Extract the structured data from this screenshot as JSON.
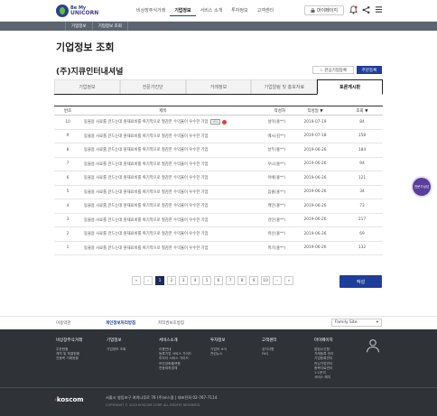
{
  "header": {
    "logo_line1": "Be My",
    "logo_line2": "UNICORN",
    "nav": [
      "비상장주식거래",
      "기업정보",
      "서비스 소개",
      "투자정보",
      "고객센터"
    ],
    "active_nav": "기업정보",
    "mypage": "마이페이지"
  },
  "breadcrumb": [
    "기업정보",
    "기업정보 조회"
  ],
  "page_title": "기업정보 조회",
  "company_name": "(주)지큐인터내셔널",
  "buttons": {
    "watch": "☆ 관심기업등록",
    "stock": "주문등록",
    "write": "작성"
  },
  "tabs": [
    "기업정보",
    "전문가진단",
    "거래정보",
    "기업알림 및 홍보자료",
    "토론게시판"
  ],
  "active_tab": "토론게시판",
  "table": {
    "headers": [
      "번호",
      "제목",
      "작성자",
      "작성일 ▼",
      "조회 ▼"
    ],
    "rows": [
      {
        "no": "10",
        "title": "동물용 사료를 만드는데 원재료비를 획기적으로 절감한 수익율이 우수한 기업",
        "writer": "설이(홍**)",
        "date": "2019-07-19",
        "views": "84",
        "img": "IMG"
      },
      {
        "no": "9",
        "title": "동물용 사료를 만드는데 원재료비를 획기적으로 절감한 수익율이 우수한 기업",
        "writer": "메시(김**)",
        "date": "2019-07-18",
        "views": "158"
      },
      {
        "no": "8",
        "title": "동물용 사료를 만드는데 원재료비를 획기적으로 절감한 수익율이 우수한 기업",
        "writer": "날두(홍**)",
        "date": "2019-06-26",
        "views": "184"
      },
      {
        "no": "7",
        "title": "동물용 사료를 만드는데 원재료비를 획기적으로 절감한 수익율이 우수한 기업",
        "writer": "우니(홍**)",
        "date": "2019-06-26",
        "views": "94"
      },
      {
        "no": "6",
        "title": "동물용 사료를 만드는데 원재료비를 획기적으로 절감한 수익율이 우수한 기업",
        "writer": "이베(홍**)",
        "date": "2019-06-26",
        "views": "121"
      },
      {
        "no": "5",
        "title": "동물용 사료를 만드는데 원재료비를 획기적으로 절감한 수익율이 우수한 기업",
        "writer": "음콜(홍**)",
        "date": "2019-06-26",
        "views": "34"
      },
      {
        "no": "4",
        "title": "동물용 사료를 만드는데 원재료비를 획기적으로 절감한 수익율이 우수한 기업",
        "writer": "케인(홍**)",
        "date": "2019-06-26",
        "views": "73"
      },
      {
        "no": "3",
        "title": "동물용 사료를 만드는데 원재료비를 획기적으로 절감한 수익율이 우수한 기업",
        "writer": "강인(홍**)",
        "date": "2019-06-26",
        "views": "217"
      },
      {
        "no": "2",
        "title": "동물용 사료를 만드는데 원재료비를 획기적으로 절감한 수익율이 우수한 기업",
        "writer": "박신(홍**)",
        "date": "2019-06-26",
        "views": "69"
      },
      {
        "no": "1",
        "title": "동물용 사료를 만드는데 원재료비를 획기적으로 절감한 수익율이 우수한 기업",
        "writer": "퍼기(홍**)",
        "date": "2019-06-26",
        "views": "132"
      }
    ]
  },
  "pagination": {
    "first": "«",
    "prev": "‹",
    "pages": [
      "1",
      "2",
      "3",
      "4",
      "5",
      "6",
      "7",
      "8",
      "9",
      "10"
    ],
    "current": "1",
    "next": "›",
    "last": "»"
  },
  "consult": "전문가상담",
  "footer_links": [
    "이용약관",
    "개인정보처리방침",
    "저작권보호방침"
  ],
  "family_site": {
    "label": "Family Site",
    "arrow": "▾"
  },
  "footer_columns": [
    {
      "title": "비상장주식거래",
      "items": [
        "주문현황",
        "계약 및 체결현황",
        "전종목 거래현황"
      ]
    },
    {
      "title": "기업정보",
      "items": [
        "기업정보 조회"
      ]
    },
    {
      "title": "서비스소개",
      "items": [
        "이용안내",
        "등록기업 서비스 가이드",
        "투자자 서비스 가이드",
        "보안강화플랫폼",
        "연동제휴업체"
      ]
    },
    {
      "title": "투자정보",
      "items": [
        "기업의 소식",
        "관련뉴스"
      ]
    },
    {
      "title": "고객센터",
      "items": [
        "공지사항",
        "FAQ"
      ]
    },
    {
      "title": "마이페이지",
      "items": [
        "알림수신함",
        "거래등록 관리",
        "기업등록관리",
        "관심기업관리",
        "종목자료관리",
        "1:1문의",
        "서비스 해지"
      ]
    }
  ],
  "footer": {
    "brand": "koscom",
    "brand_mark": "›",
    "address": "서울시 영등포구 여의나루로 76 (주)코스콤   |   대표전화 02-767-7114",
    "copyright": "COPYRIGHT © 2019 KOSCOM CORP. ALL RIGHTS RESERVED."
  },
  "colors": {
    "primary": "#1f3e99",
    "footer_bg": "#2f3338",
    "breadcrumb_bg": "#5b6470",
    "consult": "#5a3e9c"
  }
}
